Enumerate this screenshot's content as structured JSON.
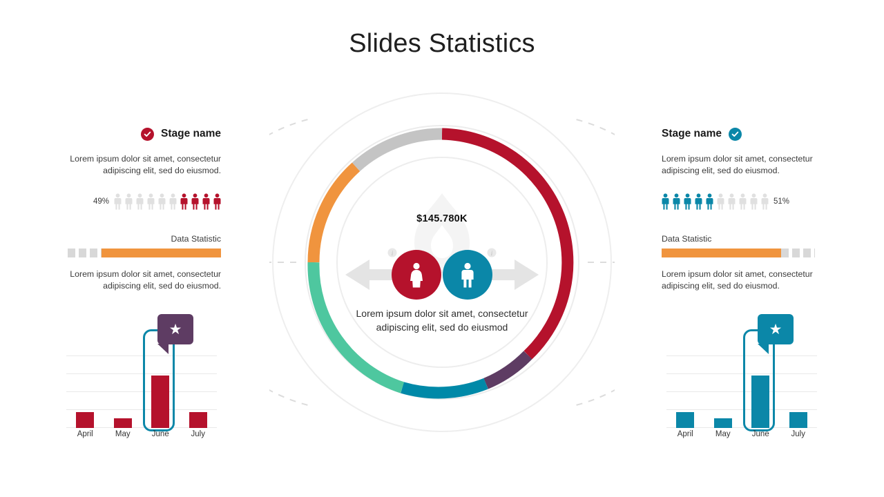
{
  "slide": {
    "title": "Slides Statistics",
    "background": "#ffffff"
  },
  "colors": {
    "red": "#b5122c",
    "teal": "#0b87a8",
    "orange": "#f0943e",
    "green": "#4ec79f",
    "purple": "#5e3c63",
    "gray": "#c4c4c4",
    "light_gray": "#e2e2e2"
  },
  "left_panel": {
    "badge_icon": "check-circle-icon",
    "badge_color": "#b5122c",
    "stage_name": "Stage name",
    "description": "Lorem ipsum dolor sit amet, consectetur adipiscing elit, sed do eiusmod.",
    "percent": "49%",
    "people_total": 10,
    "people_filled": 4,
    "people_color": "#b5122c",
    "stat_label": "Data Statistic",
    "stat_fill_percent": 78,
    "stat_fill_color": "#f0943e",
    "stat_description": "Lorem ipsum dolor sit amet, consectetur adipiscing elit, sed do eiusmod.",
    "chart": {
      "type": "bar",
      "categories": [
        "April",
        "May",
        "June",
        "July"
      ],
      "values": [
        22,
        13,
        72,
        22
      ],
      "ylim": [
        0,
        100
      ],
      "bar_color": "#b5122c",
      "highlight_category": "June",
      "highlight_color": "#0b87a8",
      "callout_icon": "star-icon",
      "callout_color": "#5e3c63",
      "gridlines": 5
    }
  },
  "right_panel": {
    "badge_icon": "check-circle-icon",
    "badge_color": "#0b87a8",
    "stage_name": "Stage name",
    "description": "Lorem ipsum dolor sit amet, consectetur adipiscing elit, sed do eiusmod.",
    "percent": "51%",
    "people_total": 10,
    "people_filled": 5,
    "people_color": "#0b87a8",
    "stat_label": "Data Statistic",
    "stat_fill_percent": 78,
    "stat_fill_color": "#f0943e",
    "stat_description": "Lorem ipsum dolor sit amet, consectetur adipiscing elit, sed do eiusmod.",
    "chart": {
      "type": "bar",
      "categories": [
        "April",
        "May",
        "June",
        "July"
      ],
      "values": [
        22,
        13,
        72,
        22
      ],
      "ylim": [
        0,
        100
      ],
      "bar_color": "#0b87a8",
      "highlight_category": "June",
      "highlight_color": "#0b87a8",
      "callout_icon": "star-icon",
      "callout_color": "#0b87a8",
      "gridlines": 5
    }
  },
  "center": {
    "value": "$145.780K",
    "description": "Lorem ipsum dolor sit amet, consectetur adipiscing elit, sed do eiusmod",
    "watermark_icon": "flame-icon",
    "left_icon": "female-icon",
    "right_icon": "male-icon",
    "left_arrow_icon": "arrow-left-icon",
    "right_arrow_icon": "arrow-right-icon",
    "info_icon": "info-icon"
  },
  "chart_data": {
    "type": "pie",
    "title": "Slides Statistics",
    "subtitle": "$145.780K",
    "labels": [
      "Red segment",
      "Purple segment",
      "Teal segment",
      "Green segment",
      "Orange segment",
      "Gray segment"
    ],
    "values": [
      38,
      7,
      12,
      22,
      13,
      8
    ],
    "colors": [
      "#b5122c",
      "#5e3c63",
      "#0089a8",
      "#4ec79f",
      "#f0943e",
      "#c4c4c4"
    ],
    "start_angle_deg": 0,
    "direction": "clockwise",
    "donut": true,
    "inner_radius_ratio": 0.9,
    "legend": "none"
  }
}
